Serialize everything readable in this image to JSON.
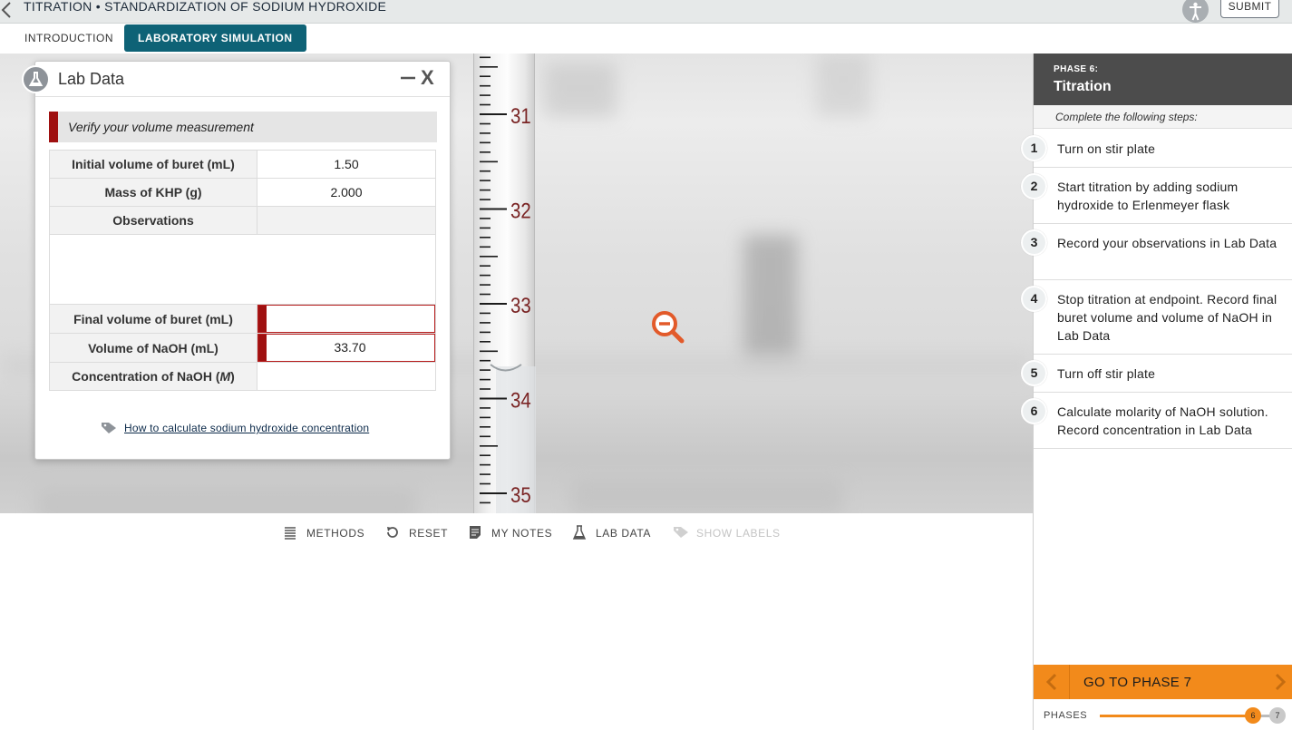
{
  "header": {
    "title": "TITRATION • STANDARDIZATION OF SODIUM HYDROXIDE",
    "submit_label": "SUBMIT"
  },
  "tabs": [
    {
      "label": "INTRODUCTION",
      "active": false
    },
    {
      "label": "LABORATORY SIMULATION",
      "active": true
    }
  ],
  "buret": {
    "scale_labels": [
      "31",
      "32",
      "33",
      "34",
      "35"
    ],
    "unit": "mL"
  },
  "lab_data": {
    "title": "Lab Data",
    "verify_message": "Verify your volume measurement",
    "rows": {
      "initial_volume": {
        "label": "Initial volume of buret (mL)",
        "value": "1.50"
      },
      "mass_khp": {
        "label": "Mass of KHP (g)",
        "value": "2.000"
      },
      "observations": {
        "label": "Observations",
        "value": ""
      },
      "final_volume": {
        "label": "Final volume of buret (mL)",
        "value": ""
      },
      "volume_naoh": {
        "label": "Volume of NaOH (mL)",
        "value": "33.70"
      },
      "concentration_label_prefix": "Concentration of NaOH (",
      "concentration_label_unit": "M",
      "concentration_label_suffix": ")",
      "concentration_value": ""
    },
    "help_link": "How to calculate sodium hydroxide concentration"
  },
  "toolbar": {
    "methods": "METHODS",
    "reset": "RESET",
    "my_notes": "MY NOTES",
    "lab_data": "LAB DATA",
    "show_labels": "SHOW LABELS"
  },
  "phase": {
    "small_label": "PHASE 6:",
    "title": "Titration",
    "steps_intro": "Complete the following steps:",
    "steps": [
      {
        "num": "1",
        "text": "Turn on stir plate"
      },
      {
        "num": "2",
        "text": "Start titration by adding sodium hydroxide to Erlenmeyer flask"
      },
      {
        "num": "3",
        "text": "Record your observations in Lab Data"
      },
      {
        "num": "4",
        "text": "Stop titration at endpoint. Record final buret volume and volume of NaOH in Lab Data"
      },
      {
        "num": "5",
        "text": "Turn off stir plate"
      },
      {
        "num": "6",
        "text": "Calculate molarity of NaOH solution. Record concentration in Lab Data"
      }
    ],
    "next_label": "GO TO PHASE 7",
    "phases_label": "PHASES",
    "current_phase": "6",
    "next_phase": "7"
  },
  "colors": {
    "accent_teal": "#0e6276",
    "accent_orange": "#f28a1b",
    "error_red": "#9f1010",
    "zoom_icon": "#e25a2a"
  }
}
